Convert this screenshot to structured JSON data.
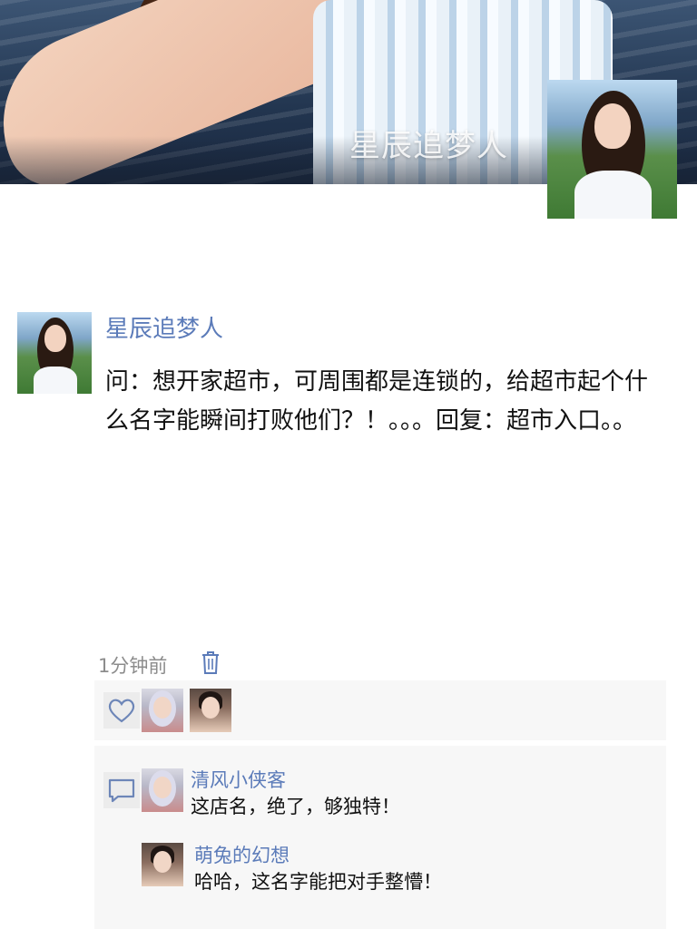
{
  "profile": {
    "cover_name": "星辰追梦人"
  },
  "post": {
    "username": "星辰追梦人",
    "text": "问：想开家超市，可周围都是连锁的，给超市起个什么名字能瞬间打败他们？！。。。回复：超市入口。。",
    "time": "1分钟前"
  },
  "icons": {
    "delete": "trash-icon",
    "like": "heart-icon",
    "comment": "comment-icon"
  },
  "comments": [
    {
      "name": "清风小侠客",
      "text": "这店名，绝了，够独特！"
    },
    {
      "name": "萌兔的幻想",
      "text": "哈哈，这名字能把对手整懵！"
    }
  ],
  "colors": {
    "accent": "#5b7bb9",
    "panel": "#f7f7f7"
  }
}
